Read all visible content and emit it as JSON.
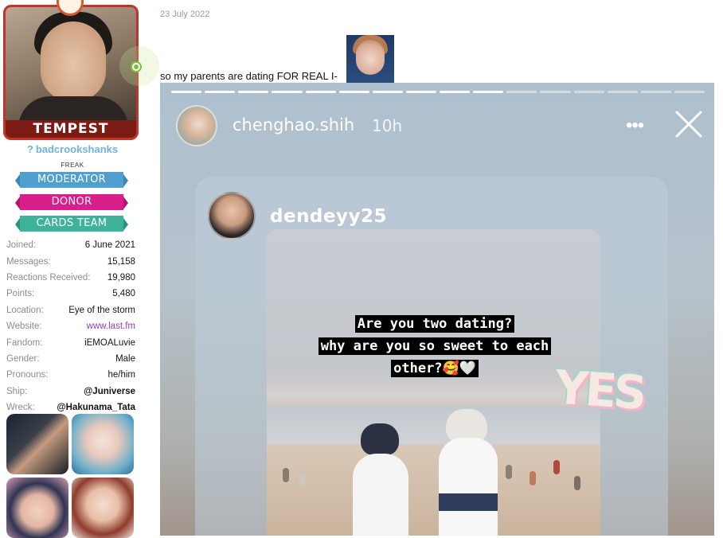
{
  "user": {
    "avatar_banner": "TEMPEST",
    "username": "badcrookshanks",
    "username_prefix": "?",
    "title": "FREAK",
    "badges": [
      {
        "label": "MODERATOR",
        "color": "#4f9fcf"
      },
      {
        "label": "DONOR",
        "color": "#d81f8c"
      },
      {
        "label": "CARDS TEAM",
        "color": "#3fb39a"
      }
    ],
    "stats": [
      {
        "label": "Joined:",
        "value": "6 June 2021"
      },
      {
        "label": "Messages:",
        "value": "15,158"
      },
      {
        "label": "Reactions Received:",
        "value": "19,980"
      },
      {
        "label": "Points:",
        "value": "5,480"
      },
      {
        "label": "Location:",
        "value": "Eye of the storm"
      },
      {
        "label": "Website:",
        "value": "www.last.fm"
      },
      {
        "label": "Fandom:",
        "value": "iEMOALuvie"
      },
      {
        "label": "Gender:",
        "value": "Male"
      },
      {
        "label": "Pronouns:",
        "value": "he/him"
      },
      {
        "label": "Ship:",
        "value": "@Juniverse"
      },
      {
        "label": "Wreck:",
        "value": "@Hakunama_Tata"
      }
    ],
    "online": true
  },
  "post": {
    "date": "23 July 2022",
    "text": "so my parents are dating FOR REAL I-"
  },
  "story": {
    "username": "chenghao.shih",
    "time": "10h",
    "more_icon": "more-dots-icon",
    "close_icon": "close-icon",
    "progress_total": 16,
    "progress_done": 10,
    "reposted_user": "dendeyy25",
    "caption_lines": [
      "Are you two dating?",
      "why are you so sweet to each",
      "other?🥰🤍"
    ],
    "sticker": "YES"
  },
  "colors": {
    "accent_link": "#8f3fbf",
    "username": "#6fb2de",
    "avatar_border": "#c0342b"
  }
}
